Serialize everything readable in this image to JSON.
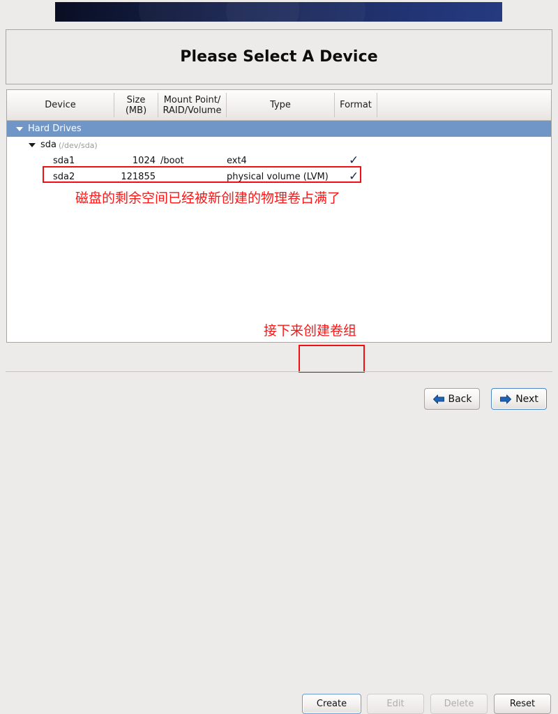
{
  "banner": {
    "name": "installer-banner"
  },
  "header": {
    "title": "Please Select A Device"
  },
  "table": {
    "columns": [
      {
        "key": "device",
        "label": "Device"
      },
      {
        "key": "size",
        "label": "Size\n(MB)",
        "line1": "Size",
        "line2": "(MB)"
      },
      {
        "key": "mount",
        "label": "Mount Point/\nRAID/Volume",
        "line1": "Mount Point/",
        "line2": "RAID/Volume"
      },
      {
        "key": "type",
        "label": "Type"
      },
      {
        "key": "format",
        "label": "Format"
      }
    ],
    "rows": [
      {
        "kind": "group",
        "expander": "chevron-down-icon",
        "device": "Hard Drives",
        "size": "",
        "mount": "",
        "type": "",
        "format": "",
        "selected": true
      },
      {
        "kind": "disk",
        "expander": "chevron-down-icon",
        "device": "sda",
        "device_path": "(/dev/sda)",
        "size": "",
        "mount": "",
        "type": "",
        "format": ""
      },
      {
        "kind": "partition",
        "device": "sda1",
        "size": "1024",
        "mount": "/boot",
        "type": "ext4",
        "format": "check-icon",
        "highlighted": false
      },
      {
        "kind": "partition",
        "device": "sda2",
        "size": "121855",
        "mount": "",
        "type": "physical volume (LVM)",
        "format": "check-icon",
        "highlighted": true
      }
    ]
  },
  "annotations": [
    {
      "id": "annot-1",
      "text": "磁盘的剩余空间已经被新创建的物理卷占满了",
      "color": "#ff1414"
    },
    {
      "id": "annot-2",
      "text": "接下来创建卷组",
      "color": "#ff1414"
    }
  ],
  "actions": {
    "create": {
      "label": "Create",
      "enabled": true,
      "focused": true,
      "annotated": true
    },
    "edit": {
      "label": "Edit",
      "enabled": false
    },
    "delete": {
      "label": "Delete",
      "enabled": false
    },
    "reset": {
      "label": "Reset",
      "enabled": true
    }
  },
  "navigation": {
    "back": {
      "label": "Back",
      "icon": "arrow-left-icon"
    },
    "next": {
      "label": "Next",
      "icon": "arrow-right-icon",
      "focused": true
    }
  },
  "colors": {
    "page_background": "#edebe9",
    "selection_blue": "#7096c8",
    "annotation_red": "#ff1414",
    "banner_dark": "#090e22",
    "banner_light": "#253a80",
    "focus_blue": "#4a86c8"
  }
}
